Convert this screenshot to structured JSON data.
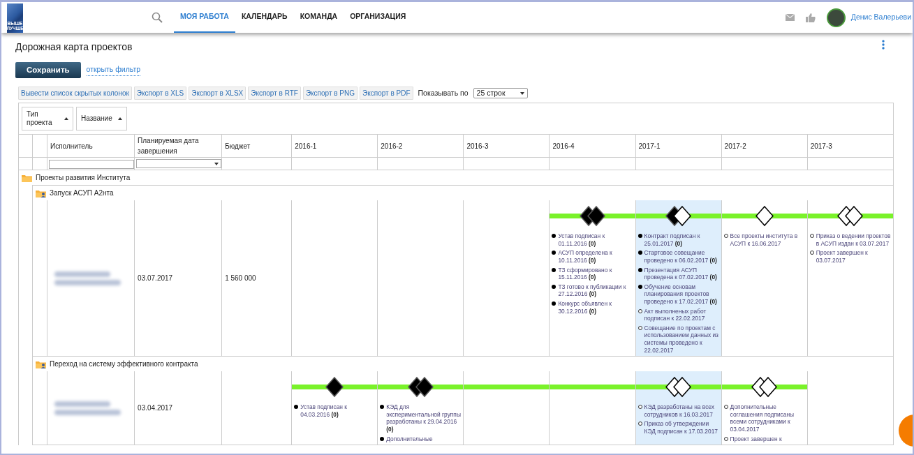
{
  "nav": {
    "logo_lines": [
      "ВЫШЕ",
      "ЛУЧШЕ"
    ],
    "tabs": [
      {
        "label": "МОЯ РАБОТА",
        "selected": true
      },
      {
        "label": "КАЛЕНДАРЬ",
        "selected": false
      },
      {
        "label": "КОМАНДА",
        "selected": false
      },
      {
        "label": "ОРГАНИЗАЦИЯ",
        "selected": false
      }
    ],
    "user_name": "Денис Валерьеви"
  },
  "page_title": "Дорожная карта проектов",
  "save_button": "Сохранить",
  "filter_link": "открыть фильтр",
  "toolbar": {
    "buttons": [
      "Вывести список скрытых колонок",
      "Экспорт в XLS",
      "Экспорт в XLSX",
      "Экспорт в RTF",
      "Экспорт в PNG",
      "Экспорт в PDF"
    ],
    "page_size_label": "Показывать по",
    "page_size": "25 строк"
  },
  "grouping": [
    {
      "label": "Тип проекта"
    },
    {
      "label": "Название"
    }
  ],
  "table": {
    "columns": [
      "Исполнитель",
      "Планируемая дата завершения",
      "Бюджет"
    ],
    "quarters": [
      {
        "label": "2016-1",
        "current": false
      },
      {
        "label": "2016-2",
        "current": false
      },
      {
        "label": "2016-3",
        "current": false
      },
      {
        "label": "2016-4",
        "current": false
      },
      {
        "label": "2017-1",
        "current": true
      },
      {
        "label": "2017-2",
        "current": false
      },
      {
        "label": "2017-3",
        "current": false
      }
    ],
    "groups": [
      {
        "name": "Проекты развития Института",
        "projects": [
          {
            "name": "Запуск АСУП А2нта",
            "due_date": "03.07.2017",
            "budget": "1 560 000",
            "cells": [
              {
                "on_timeline": false
              },
              {
                "on_timeline": false
              },
              {
                "on_timeline": false
              },
              {
                "on_timeline": true,
                "diamonds": [
                  {
                    "filled": true
                  },
                  {
                    "filled": true
                  }
                ],
                "items": [
                  {
                    "text": "Устав подписан к 01.11.2016 **(0)**",
                    "done": true
                  },
                  {
                    "text": "АСУП определена к 10.11.2016 **(0)**",
                    "done": true
                  },
                  {
                    "text": "ТЗ сформировано к 15.11.2016 **(0)**",
                    "done": true
                  },
                  {
                    "text": "ТЗ готово к публикации к 27.12.2016 **(0)**",
                    "done": true
                  },
                  {
                    "text": "Конкурс объявлен к 30.12.2016 **(0)**",
                    "done": true
                  }
                ]
              },
              {
                "on_timeline": true,
                "diamonds": [
                  {
                    "filled": true
                  },
                  {
                    "filled": false
                  }
                ],
                "items": [
                  {
                    "text": "Контракт подписан к 25.01.2017 **(0)**",
                    "done": true
                  },
                  {
                    "text": "Стартовое совещание проведено к 06.02.2017 **(0)**",
                    "done": true
                  },
                  {
                    "text": "Презентация АСУП проведена к 07.02.2017 **(0)**",
                    "done": true
                  },
                  {
                    "text": "Обучение основам планирования проектов проведено к 17.02.2017 **(0)**",
                    "done": true
                  },
                  {
                    "text": "Акт выполненых работ подписан к 22.02.2017",
                    "done": false
                  },
                  {
                    "text": "Совещание по проектам с использованием данных из системы проведено к 22.02.2017",
                    "done": false
                  }
                ]
              },
              {
                "on_timeline": true,
                "diamonds": [
                  {
                    "filled": false
                  }
                ],
                "items": [
                  {
                    "text": "Все проекты института в АСУП к 16.06.2017",
                    "done": false
                  }
                ]
              },
              {
                "on_timeline": true,
                "diamonds": [
                  {
                    "filled": false
                  },
                  {
                    "filled": false
                  }
                ],
                "items": [
                  {
                    "text": "Приказ о ведении проектов в АСУП издан к 03.07.2017",
                    "done": false
                  },
                  {
                    "text": "Проект завершен к 03.07.2017",
                    "done": false
                  }
                ]
              }
            ]
          },
          {
            "name": "Переход на систему эффективного контракта",
            "due_date": "03.04.2017",
            "cells": [
              {
                "on_timeline": true,
                "diamonds": [
                  {
                    "filled": true
                  }
                ],
                "items": [
                  {
                    "text": "Устав подписан к 04.03.2016 **(0)**",
                    "done": true
                  }
                ]
              },
              {
                "on_timeline": true,
                "diamonds": [
                  {
                    "filled": true
                  },
                  {
                    "filled": true
                  }
                ],
                "items": [
                  {
                    "text": "КЭД для экспериментальной группы разработаны к 29.04.2016 **(0)**",
                    "done": true
                  },
                  {
                    "text": "Дополнительные",
                    "done": true
                  }
                ]
              },
              {
                "on_timeline": true
              },
              {
                "on_timeline": true
              },
              {
                "on_timeline": true,
                "diamonds": [
                  {
                    "filled": false
                  },
                  {
                    "filled": false
                  }
                ],
                "items": [
                  {
                    "text": "КЭД разработаны на всех сотрудников к 16.03.2017",
                    "done": false
                  },
                  {
                    "text": "Приказ об утверждении КЭД подписан к 17.03.2017",
                    "done": false
                  }
                ]
              },
              {
                "on_timeline": true,
                "diamonds": [
                  {
                    "filled": false
                  },
                  {
                    "filled": false
                  }
                ],
                "items": [
                  {
                    "text": "Дополнительные соглашения подписаны всеми сотрудниками к 03.04.2017",
                    "done": false
                  },
                  {
                    "text": "Проект завершен к",
                    "done": false
                  }
                ]
              },
              {
                "on_timeline": false
              }
            ]
          }
        ]
      }
    ]
  }
}
